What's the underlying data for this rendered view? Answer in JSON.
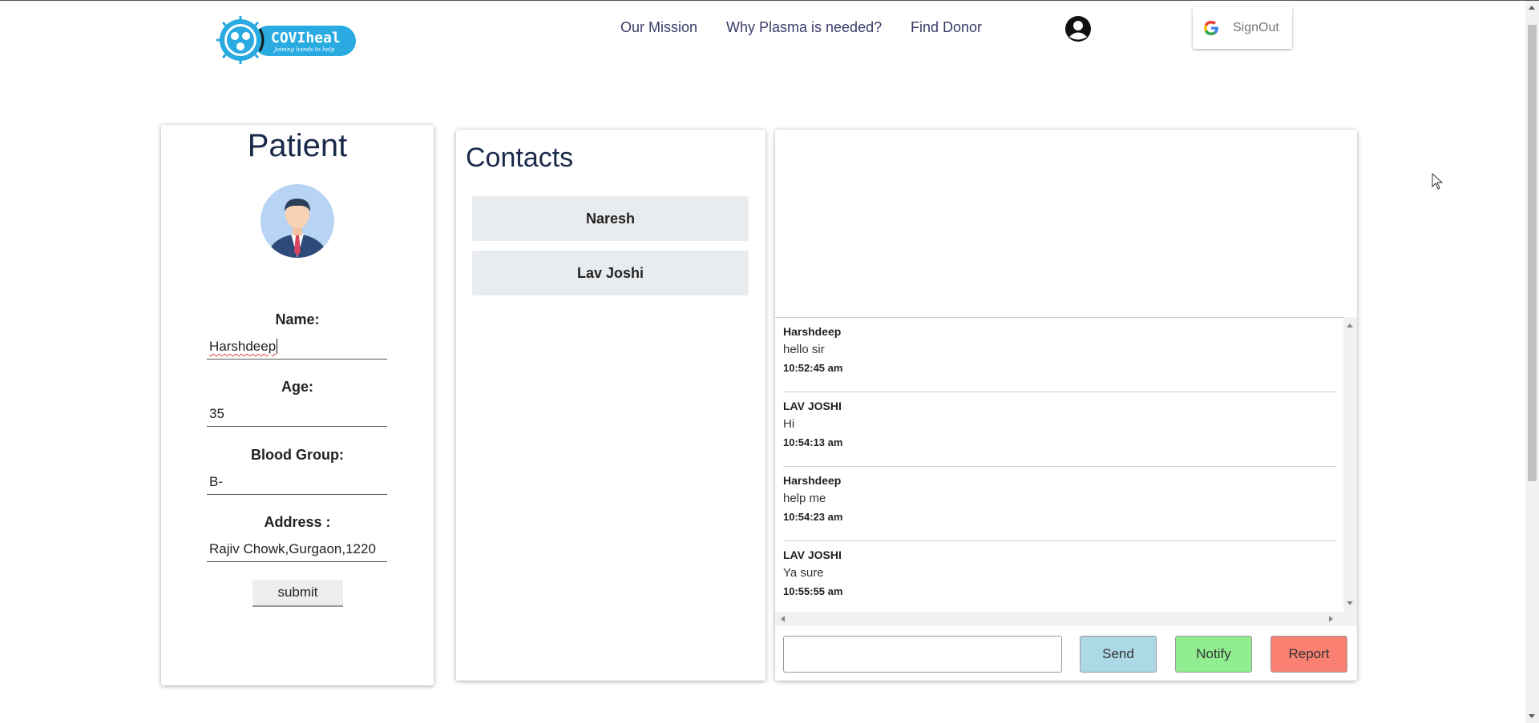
{
  "app": {
    "brand": "COVIheal",
    "tagline": "Joining hands to help"
  },
  "nav": {
    "links": [
      "Our Mission",
      "Why Plasma is needed?",
      "Find Donor"
    ],
    "signout_label": "SignOut"
  },
  "patient": {
    "title": "Patient",
    "name_label": "Name:",
    "name_value": "Harshdeep",
    "age_label": "Age:",
    "age_value": "35",
    "blood_label": "Blood Group:",
    "blood_value": "B-",
    "address_label": "Address :",
    "address_value": "Rajiv Chowk,Gurgaon,1220",
    "submit_label": "submit"
  },
  "contacts": {
    "title": "Contacts",
    "items": [
      "Naresh",
      "Lav Joshi"
    ]
  },
  "chat": {
    "messages": [
      {
        "sender": "Harshdeep",
        "text": "hello sir",
        "time": "10:52:45 am"
      },
      {
        "sender": "LAV JOSHI",
        "text": "Hi",
        "time": "10:54:13 am"
      },
      {
        "sender": "Harshdeep",
        "text": "help me",
        "time": "10:54:23 am"
      },
      {
        "sender": "LAV JOSHI",
        "text": "Ya sure",
        "time": "10:55:55 am"
      }
    ],
    "send_label": "Send",
    "notify_label": "Notify",
    "report_label": "Report"
  },
  "colors": {
    "send": "#add8e6",
    "notify": "#90ee90",
    "report": "#fa8072",
    "logo_blue": "#29abe2"
  }
}
